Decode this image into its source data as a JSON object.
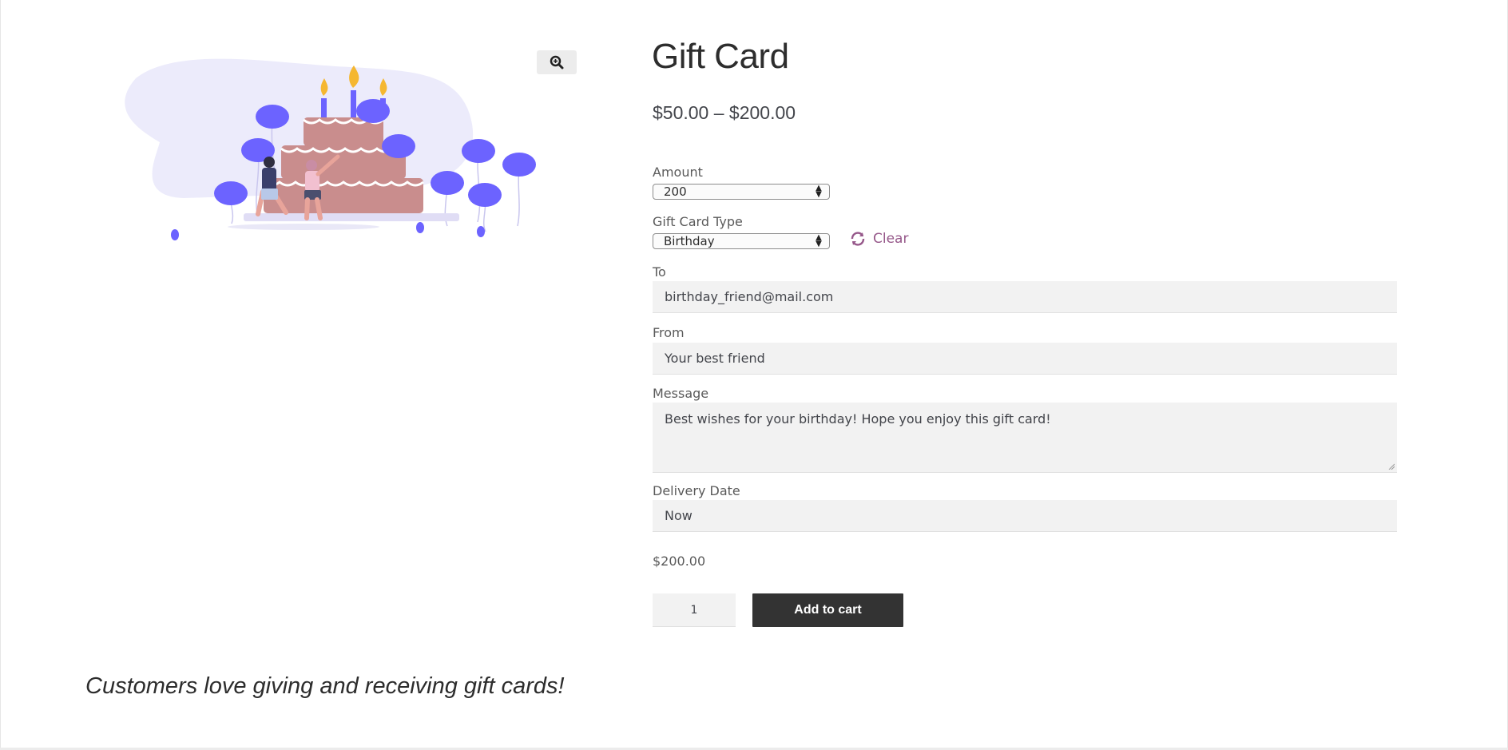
{
  "product": {
    "title": "Gift Card",
    "price_range": "$50.00 – $200.00"
  },
  "image": {
    "zoom_icon": "zoom-in-icon",
    "illustration": "birthday-cake-illustration",
    "colors": {
      "balloon": "#6c63ff",
      "cake": "#c98d8d",
      "blob": "#ecebfb"
    }
  },
  "form": {
    "amount": {
      "label": "Amount",
      "value": "200"
    },
    "card_type": {
      "label": "Gift Card Type",
      "value": "Birthday",
      "clear_label": "Clear",
      "clear_icon": "refresh-icon"
    },
    "to": {
      "label": "To",
      "value": "birthday_friend@mail.com"
    },
    "from": {
      "label": "From",
      "value": "Your best friend"
    },
    "message": {
      "label": "Message",
      "value": "Best wishes for your birthday! Hope you enjoy this gift card!"
    },
    "delivery_date": {
      "label": "Delivery Date",
      "value": "Now"
    }
  },
  "price": "$200.00",
  "quantity": "1",
  "add_to_cart": "Add to cart",
  "tagline": "Customers love giving and receiving gift cards!",
  "colors": {
    "accent": "#96588a",
    "button": "#333333",
    "field_bg": "#f2f2f2"
  }
}
